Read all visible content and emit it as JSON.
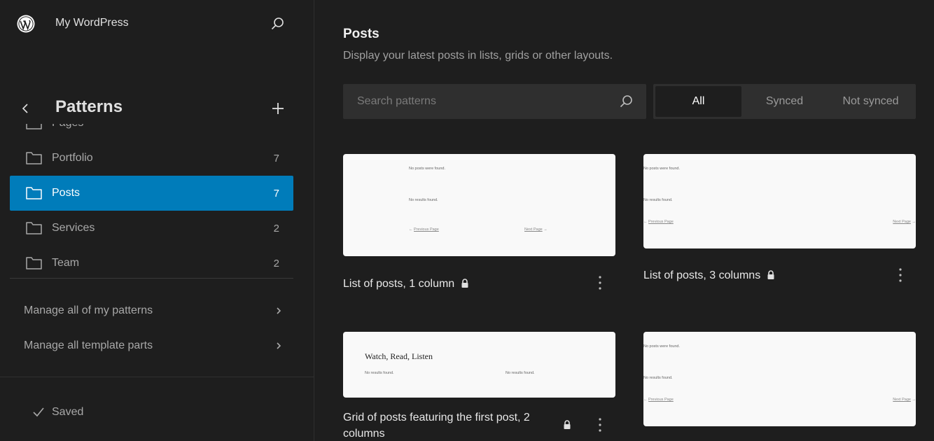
{
  "site": {
    "title": "My WordPress"
  },
  "sidebar": {
    "title": "Patterns",
    "items": [
      {
        "label": "Pages",
        "count": ""
      },
      {
        "label": "Portfolio",
        "count": "7"
      },
      {
        "label": "Posts",
        "count": "7",
        "active": true
      },
      {
        "label": "Services",
        "count": "2"
      },
      {
        "label": "Team",
        "count": "2"
      }
    ],
    "manage_links": [
      {
        "label": "Manage all of my patterns"
      },
      {
        "label": "Manage all template parts"
      }
    ],
    "status": "Saved"
  },
  "main": {
    "title": "Posts",
    "description": "Display your latest posts in lists, grids or other layouts.",
    "search": {
      "placeholder": "Search patterns",
      "value": ""
    },
    "filters": [
      {
        "label": "All",
        "active": true
      },
      {
        "label": "Synced",
        "active": false
      },
      {
        "label": "Not synced",
        "active": false
      }
    ],
    "patterns": [
      {
        "title": "List of posts, 1 column",
        "locked": true,
        "preview": {
          "no_posts": "No posts were found.",
          "no_results": "No results found.",
          "prev": "Previous Page",
          "next": "Next Page"
        }
      },
      {
        "title": "List of posts, 3 columns",
        "locked": true,
        "preview": {
          "no_posts": "No posts were found.",
          "no_results": "No results found.",
          "prev": "Previous Page",
          "next": "Next Page"
        }
      },
      {
        "title": "Grid of posts featuring the first post, 2 columns",
        "locked": true,
        "preview": {
          "heading": "Watch, Read, Listen",
          "no_results_left": "No results found.",
          "no_results_right": "No results found."
        }
      },
      {
        "title": "",
        "locked": false,
        "preview": {
          "no_posts": "No posts were found.",
          "no_results": "No results found.",
          "prev": "Previous Page",
          "next": "Next Page"
        }
      }
    ]
  }
}
